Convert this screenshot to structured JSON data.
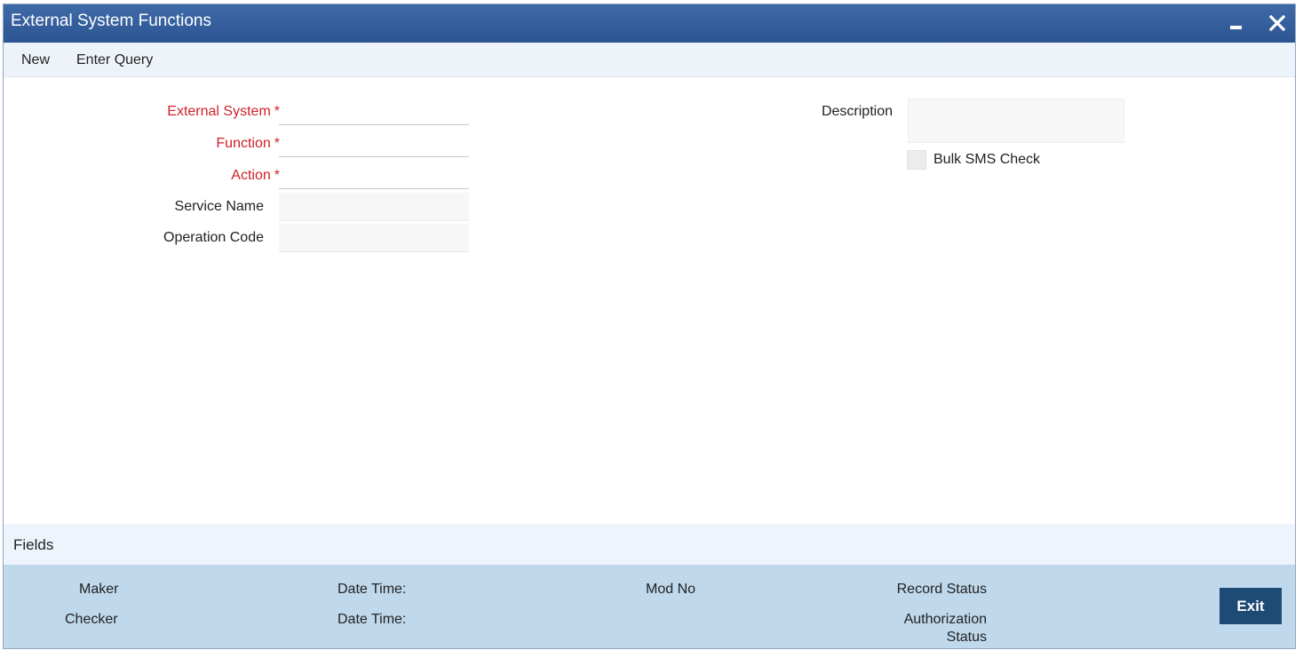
{
  "window": {
    "title": "External System Functions"
  },
  "toolbar": {
    "new_label": "New",
    "enter_query_label": "Enter Query"
  },
  "form": {
    "external_system": {
      "label": "External System",
      "required": "*",
      "value": ""
    },
    "function": {
      "label": "Function",
      "required": "*",
      "value": ""
    },
    "action": {
      "label": "Action",
      "required": "*",
      "value": ""
    },
    "service_name": {
      "label": "Service Name",
      "value": ""
    },
    "operation_code": {
      "label": "Operation Code",
      "value": ""
    },
    "description": {
      "label": "Description",
      "value": ""
    },
    "bulk_sms_check": {
      "label": "Bulk SMS Check",
      "checked": false
    }
  },
  "fields_section": {
    "label": "Fields"
  },
  "footer": {
    "maker_label": "Maker",
    "checker_label": "Checker",
    "date_time_label_1": "Date Time:",
    "date_time_label_2": "Date Time:",
    "mod_no_label": "Mod No",
    "record_status_label": "Record Status",
    "authorization_label": "Authorization",
    "authorization_status_label": "Status",
    "exit_label": "Exit"
  },
  "colors": {
    "titlebar": "#2c5592",
    "required_label": "#d0212a",
    "footer_bg": "#bfd8ec",
    "exit_button": "#1e4a76"
  }
}
